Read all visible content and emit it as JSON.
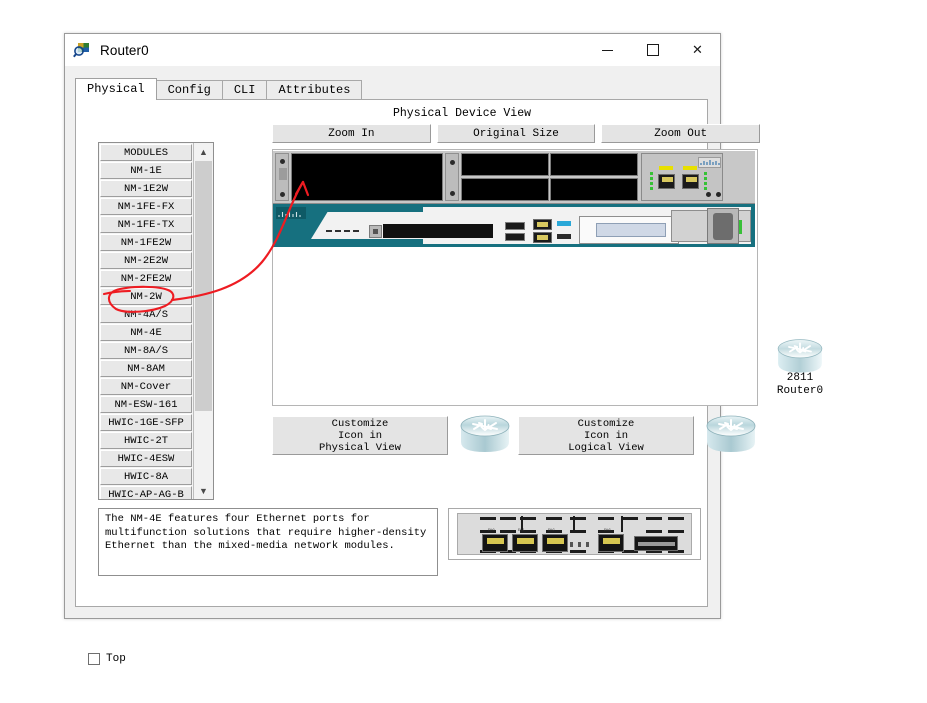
{
  "window": {
    "title": "Router0",
    "icon": "packet-tracer-icon",
    "controls": {
      "minimize": "—",
      "maximize": "□",
      "close": "✕"
    }
  },
  "tabs": [
    {
      "label": "Physical",
      "active": true
    },
    {
      "label": "Config",
      "active": false
    },
    {
      "label": "CLI",
      "active": false
    },
    {
      "label": "Attributes",
      "active": false
    }
  ],
  "modules": {
    "header": "MODULES",
    "items": [
      "NM-1E",
      "NM-1E2W",
      "NM-1FE-FX",
      "NM-1FE-TX",
      "NM-1FE2W",
      "NM-2E2W",
      "NM-2FE2W",
      "NM-2W",
      "NM-4A/S",
      "NM-4E",
      "NM-8A/S",
      "NM-8AM",
      "NM-Cover",
      "NM-ESW-161",
      "HWIC-1GE-SFP",
      "HWIC-2T",
      "HWIC-4ESW",
      "HWIC-8A",
      "HWIC-AP-AG-B"
    ],
    "selected": "NM-4E"
  },
  "device_view": {
    "title": "Physical Device View",
    "zoom_in": "Zoom In",
    "original_size": "Original Size",
    "zoom_out": "Zoom Out"
  },
  "customize": {
    "physical": {
      "line1": "Customize",
      "line2": "Icon in",
      "line3": "Physical View"
    },
    "logical": {
      "line1": "Customize",
      "line2": "Icon in",
      "line3": "Logical View"
    }
  },
  "description": "The NM-4E features four Ethernet ports for multifunction solutions that require higher-density Ethernet than the mixed-media network modules.",
  "bottom": {
    "top_checkbox_label": "Top",
    "top_checked": false
  },
  "canvas": {
    "device_model": "2811",
    "device_name": "Router0"
  },
  "annotation": {
    "color": "#ee1c22",
    "shapes": "ellipse-around-NM-4E + curved-arrow-to-empty-slot"
  },
  "colors": {
    "window_bg": "#f0f0f0",
    "chassis_teal": "#16707f",
    "annotation_red": "#ee1c22",
    "accent_border": "#a8a8a8"
  }
}
